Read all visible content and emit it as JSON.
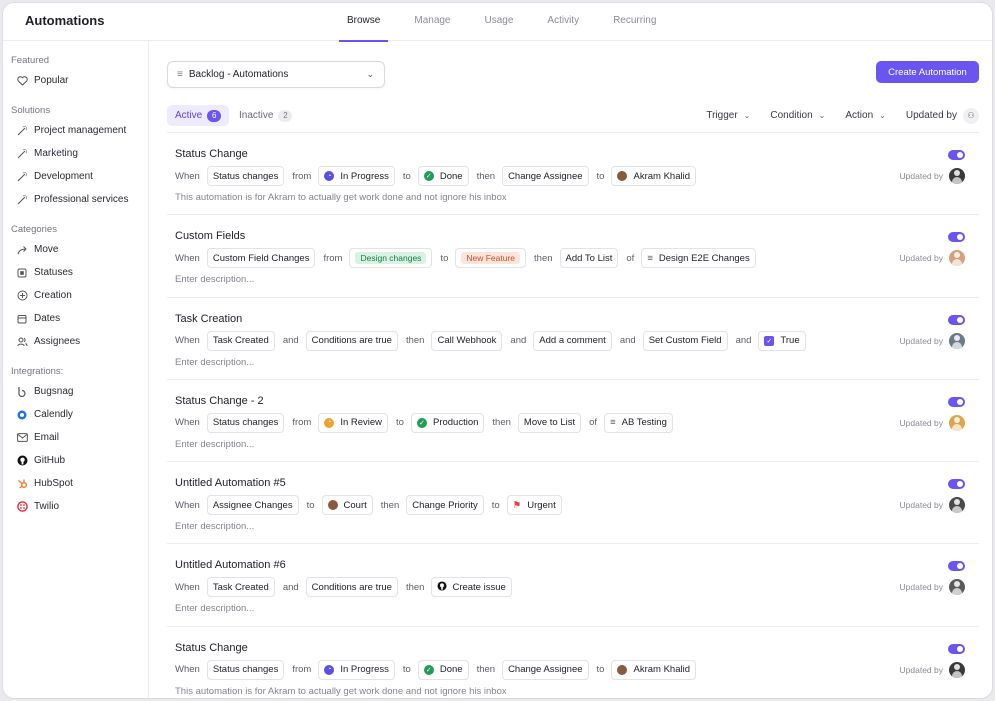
{
  "app": {
    "title": "Automations"
  },
  "tabs": [
    {
      "label": "Browse",
      "active": true
    },
    {
      "label": "Manage",
      "active": false
    },
    {
      "label": "Usage",
      "active": false
    },
    {
      "label": "Activity",
      "active": false
    },
    {
      "label": "Recurring",
      "active": false
    }
  ],
  "sidebar": {
    "featured_heading": "Featured",
    "featured": [
      {
        "label": "Popular",
        "icon": "heart-icon"
      }
    ],
    "solutions_heading": "Solutions",
    "solutions": [
      {
        "label": "Project management",
        "icon": "magic-wand-icon"
      },
      {
        "label": "Marketing",
        "icon": "magic-wand-icon"
      },
      {
        "label": "Development",
        "icon": "magic-wand-icon"
      },
      {
        "label": "Professional services",
        "icon": "magic-wand-icon"
      }
    ],
    "categories_heading": "Categories",
    "categories": [
      {
        "label": "Move",
        "icon": "move-arrow-icon"
      },
      {
        "label": "Statuses",
        "icon": "status-box-icon"
      },
      {
        "label": "Creation",
        "icon": "plus-circle-icon"
      },
      {
        "label": "Dates",
        "icon": "calendar-icon"
      },
      {
        "label": "Assignees",
        "icon": "users-icon"
      }
    ],
    "integrations_heading": "Integrations:",
    "integrations": [
      {
        "label": "Bugsnag",
        "icon": "bugsnag-icon"
      },
      {
        "label": "Calendly",
        "icon": "calendly-icon"
      },
      {
        "label": "Email",
        "icon": "email-icon"
      },
      {
        "label": "GitHub",
        "icon": "github-icon"
      },
      {
        "label": "HubSpot",
        "icon": "hubspot-icon"
      },
      {
        "label": "Twilio",
        "icon": "twilio-icon"
      }
    ]
  },
  "toolbar": {
    "list_select": "Backlog -  Automations",
    "create_label": "Create Automation"
  },
  "filters": {
    "active_label": "Active",
    "active_count": "6",
    "inactive_label": "Inactive",
    "inactive_count": "2",
    "trigger": "Trigger",
    "condition": "Condition",
    "action": "Action",
    "updated_by": "Updated by"
  },
  "updated_by_label": "Updated by",
  "colors": {
    "accent": "#6a55f0",
    "done": "#1f9d55",
    "in_progress": "#5b4fe8",
    "review": "#f0a12f",
    "urgent": "#e53e3e"
  },
  "rules": [
    {
      "title": "Status Change",
      "description": "This automation is for Akram to actually get work done and not ignore his inbox",
      "avatar_color": "#3a3a3a",
      "parts": [
        {
          "kind": "kw",
          "text": "When"
        },
        {
          "kind": "chip",
          "text": "Status changes"
        },
        {
          "kind": "kw",
          "text": "from"
        },
        {
          "kind": "chip",
          "text": "In Progress",
          "dot": "#5b4fe8",
          "dot_glyph": "◔"
        },
        {
          "kind": "kw",
          "text": "to"
        },
        {
          "kind": "chip",
          "text": "Done",
          "dot": "#1f9d55",
          "dot_glyph": "✓"
        },
        {
          "kind": "kw",
          "text": "then"
        },
        {
          "kind": "chip",
          "text": "Change Assignee"
        },
        {
          "kind": "kw",
          "text": "to"
        },
        {
          "kind": "chip",
          "text": "Akram Khalid",
          "dot": "#8a5a3c",
          "dot_glyph": ""
        }
      ]
    },
    {
      "title": "Custom Fields",
      "description": "Enter description...",
      "avatar_color": "#d8a07a",
      "parts": [
        {
          "kind": "kw",
          "text": "When"
        },
        {
          "kind": "chip",
          "text": "Custom Field Changes"
        },
        {
          "kind": "kw",
          "text": "from"
        },
        {
          "kind": "chip",
          "text": "Design changes",
          "tag_bg": "#d9f2e3",
          "tag_fg": "#1e7a46"
        },
        {
          "kind": "kw",
          "text": "to"
        },
        {
          "kind": "chip",
          "text": "New Feature",
          "tag_bg": "#fde5dc",
          "tag_fg": "#c2512b"
        },
        {
          "kind": "kw",
          "text": "then"
        },
        {
          "kind": "chip",
          "text": "Add To List"
        },
        {
          "kind": "kw",
          "text": "of"
        },
        {
          "kind": "chip",
          "text": "Design E2E Changes",
          "list_icon": "≡"
        }
      ]
    },
    {
      "title": "Task Creation",
      "description": "Enter description...",
      "avatar_color": "#6b7a86",
      "parts": [
        {
          "kind": "kw",
          "text": "When"
        },
        {
          "kind": "chip",
          "text": "Task Created"
        },
        {
          "kind": "kw",
          "text": "and"
        },
        {
          "kind": "chip",
          "text": "Conditions are true"
        },
        {
          "kind": "kw",
          "text": "then"
        },
        {
          "kind": "chip",
          "text": "Call Webhook"
        },
        {
          "kind": "kw",
          "text": "and"
        },
        {
          "kind": "chip",
          "text": "Add a comment"
        },
        {
          "kind": "kw",
          "text": "and"
        },
        {
          "kind": "chip",
          "text": "Set Custom Field"
        },
        {
          "kind": "kw",
          "text": "and"
        },
        {
          "kind": "chip",
          "text": "True",
          "dot": "#6a55f0",
          "dot_glyph": "✓",
          "square": true
        }
      ]
    },
    {
      "title": "Status Change - 2",
      "description": "Enter description...",
      "avatar_color": "#e0a44a",
      "parts": [
        {
          "kind": "kw",
          "text": "When"
        },
        {
          "kind": "chip",
          "text": "Status changes"
        },
        {
          "kind": "kw",
          "text": "from"
        },
        {
          "kind": "chip",
          "text": "In Review",
          "dot": "#f0a12f",
          "dot_glyph": "◔"
        },
        {
          "kind": "kw",
          "text": "to"
        },
        {
          "kind": "chip",
          "text": "Production",
          "dot": "#1f9d55",
          "dot_glyph": "✓"
        },
        {
          "kind": "kw",
          "text": "then"
        },
        {
          "kind": "chip",
          "text": "Move to List"
        },
        {
          "kind": "kw",
          "text": "of"
        },
        {
          "kind": "chip",
          "text": "AB Testing",
          "list_icon": "≡"
        }
      ]
    },
    {
      "title": "Untitled Automation #5",
      "description": "Enter description...",
      "avatar_color": "#4a4a4a",
      "parts": [
        {
          "kind": "kw",
          "text": "When"
        },
        {
          "kind": "chip",
          "text": "Assignee Changes"
        },
        {
          "kind": "kw",
          "text": "to"
        },
        {
          "kind": "chip",
          "text": "Court",
          "dot": "#8a5a3c",
          "dot_glyph": ""
        },
        {
          "kind": "kw",
          "text": "then"
        },
        {
          "kind": "chip",
          "text": "Change Priority"
        },
        {
          "kind": "kw",
          "text": "to"
        },
        {
          "kind": "chip",
          "text": "Urgent",
          "flag": "#e53e3e"
        }
      ]
    },
    {
      "title": "Untitled Automation #6",
      "description": "Enter description...",
      "avatar_color": "#5a5a5a",
      "parts": [
        {
          "kind": "kw",
          "text": "When"
        },
        {
          "kind": "chip",
          "text": "Task Created"
        },
        {
          "kind": "kw",
          "text": "and"
        },
        {
          "kind": "chip",
          "text": "Conditions are true"
        },
        {
          "kind": "kw",
          "text": "then"
        },
        {
          "kind": "chip",
          "text": "Create issue",
          "github": true
        }
      ]
    },
    {
      "title": "Status Change",
      "description": "This automation is for Akram to actually get work done and not ignore his inbox",
      "avatar_color": "#3a3a3a",
      "parts": [
        {
          "kind": "kw",
          "text": "When"
        },
        {
          "kind": "chip",
          "text": "Status changes"
        },
        {
          "kind": "kw",
          "text": "from"
        },
        {
          "kind": "chip",
          "text": "In Progress",
          "dot": "#5b4fe8",
          "dot_glyph": "◔"
        },
        {
          "kind": "kw",
          "text": "to"
        },
        {
          "kind": "chip",
          "text": "Done",
          "dot": "#1f9d55",
          "dot_glyph": "✓"
        },
        {
          "kind": "kw",
          "text": "then"
        },
        {
          "kind": "chip",
          "text": "Change Assignee"
        },
        {
          "kind": "kw",
          "text": "to"
        },
        {
          "kind": "chip",
          "text": "Akram Khalid",
          "dot": "#8a5a3c",
          "dot_glyph": ""
        }
      ]
    }
  ]
}
